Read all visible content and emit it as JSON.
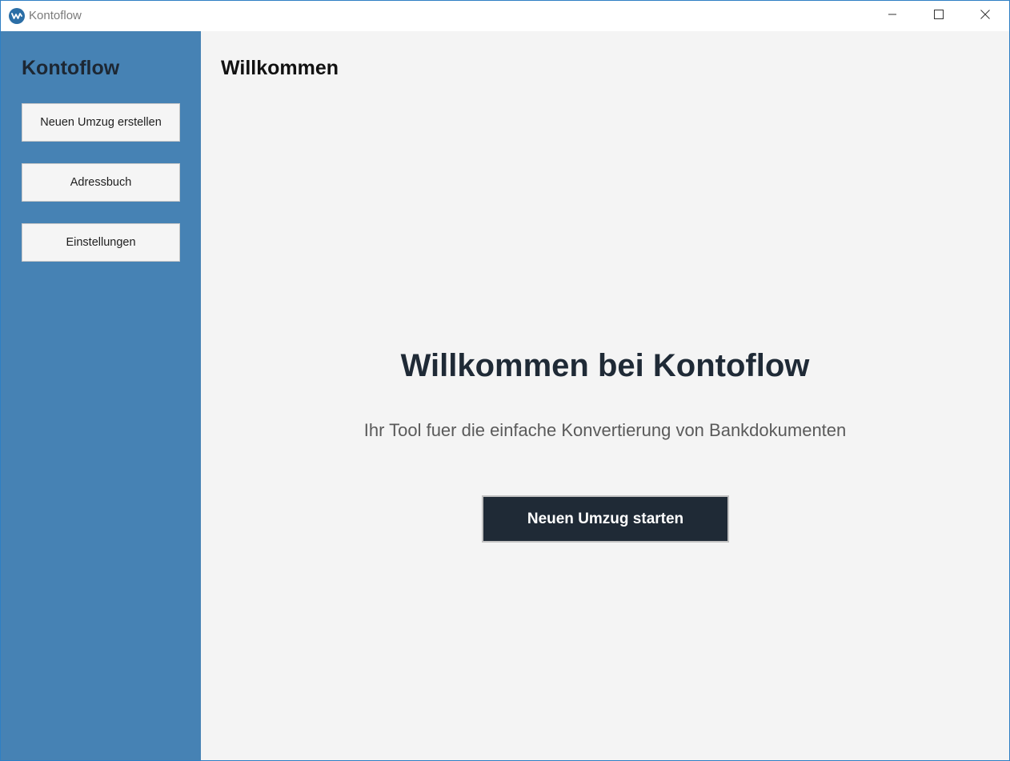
{
  "window": {
    "title": "Kontoflow",
    "icon": "kontoflow-wave-icon",
    "controls": [
      "minimize-icon",
      "maximize-icon",
      "close-icon"
    ]
  },
  "sidebar": {
    "title": "Kontoflow",
    "background_color": "#4682b4",
    "items": [
      {
        "label": "Neuen Umzug erstellen"
      },
      {
        "label": "Adressbuch"
      },
      {
        "label": "Einstellungen"
      }
    ]
  },
  "main": {
    "page_title": "Willkommen",
    "heading": "Willkommen bei Kontoflow",
    "subtitle": "Ihr Tool fuer die einfache Konvertierung von Bankdokumenten",
    "primary_button": {
      "label": "Neuen Umzug starten",
      "background_color": "#1f2a36"
    }
  }
}
